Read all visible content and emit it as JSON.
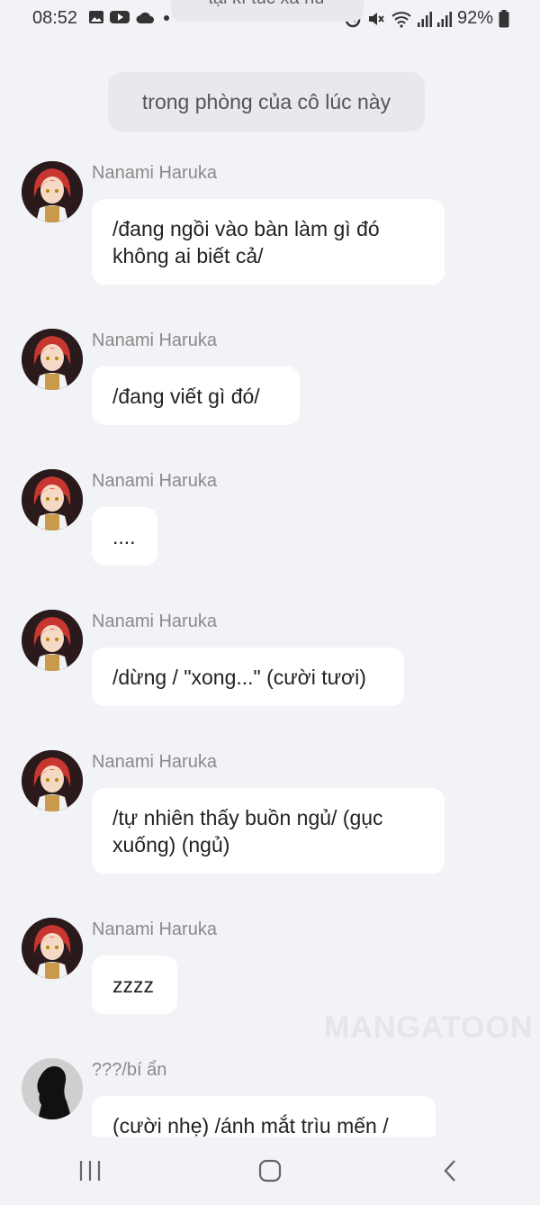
{
  "status": {
    "time": "08:52",
    "battery": "92%",
    "left_icons": [
      "gallery-icon",
      "youtube-icon",
      "cloud-icon",
      "dot-icon"
    ],
    "right_icons": [
      "alarm-icon",
      "mute-icon",
      "wifi-icon",
      "signal-icon",
      "signal-icon",
      "battery-icon"
    ]
  },
  "top_cut_bubble": "tại kí túc xá nữ",
  "scene_text": "trong phòng của cô lúc này",
  "messages": [
    {
      "sender": "Nanami Haruka",
      "text_lines": [
        "/đang ngồi vào bàn làm gì đó",
        "không ai biết cả/"
      ]
    },
    {
      "sender": "Nanami Haruka",
      "text_lines": [
        "/đang viết gì đó/"
      ]
    },
    {
      "sender": "Nanami Haruka",
      "text_lines": [
        "...."
      ]
    },
    {
      "sender": "Nanami Haruka",
      "text_lines": [
        "/dừng / \"xong...\" (cười tươi)"
      ]
    },
    {
      "sender": "Nanami Haruka",
      "text_lines": [
        "/tự nhiên thấy buồn ngủ/ (gục",
        "xuống) (ngủ)"
      ]
    },
    {
      "sender": "Nanami Haruka",
      "text_lines": [
        "zzzz"
      ]
    },
    {
      "sender": "???/bí ẩn",
      "text_lines": [
        "(cười nhẹ) /ánh mắt trìu mến /"
      ]
    }
  ],
  "watermark": "MANGATOON",
  "nav": [
    "recent-apps-icon",
    "home-icon",
    "back-icon"
  ]
}
